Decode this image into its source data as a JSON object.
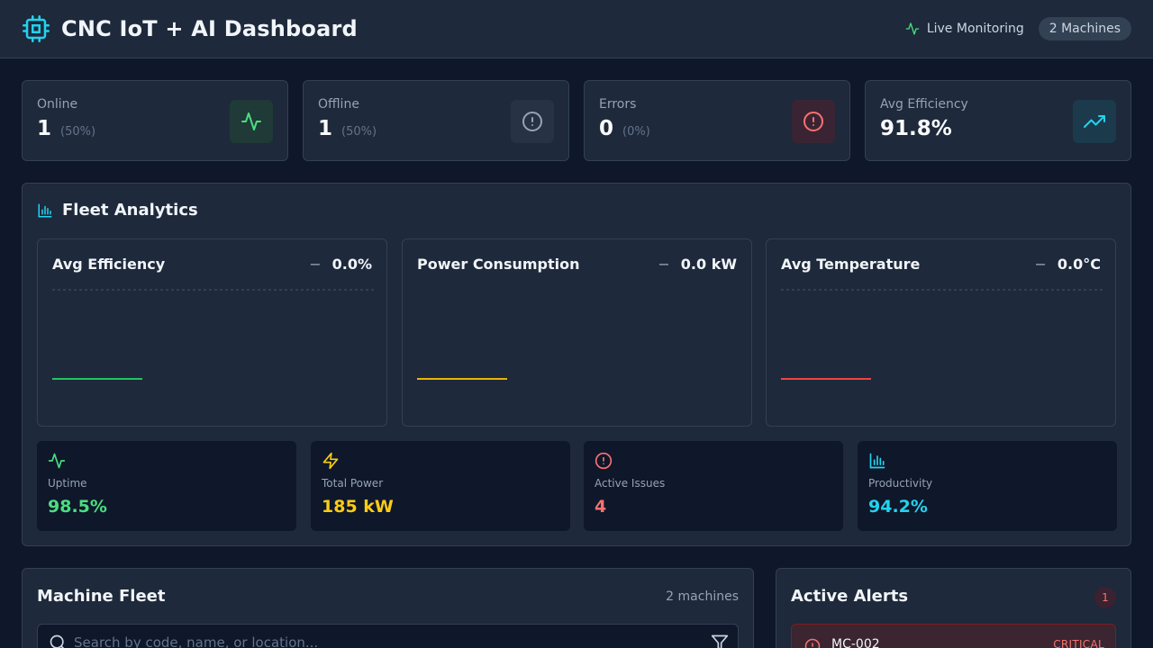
{
  "header": {
    "title": "CNC IoT + AI Dashboard",
    "live_label": "Live Monitoring",
    "machines_pill": "2 Machines",
    "icons": {
      "logo": "cpu-icon",
      "live": "activity-icon"
    }
  },
  "stats": [
    {
      "label": "Online",
      "value": "1",
      "pct": "(50%)",
      "icon": "activity-icon",
      "color": "#4ade80"
    },
    {
      "label": "Offline",
      "value": "1",
      "pct": "(50%)",
      "icon": "alert-circle-icon",
      "color": "#94a3b8"
    },
    {
      "label": "Errors",
      "value": "0",
      "pct": "(0%)",
      "icon": "alert-circle-icon",
      "color": "#f87171"
    },
    {
      "label": "Avg Efficiency",
      "value": "91.8%",
      "pct": "",
      "icon": "trending-up-icon",
      "color": "#22d3ee"
    }
  ],
  "analytics": {
    "title": "Fleet Analytics",
    "icon": "bar-chart-icon",
    "charts": [
      {
        "title": "Avg Efficiency",
        "value": "0.0%",
        "trend": "−",
        "color": "#22c55e"
      },
      {
        "title": "Power Consumption",
        "value": "0.0 kW",
        "trend": "−",
        "color": "#eab308"
      },
      {
        "title": "Avg Temperature",
        "value": "0.0°C",
        "trend": "−",
        "color": "#ef4444"
      }
    ],
    "metrics": [
      {
        "label": "Uptime",
        "value": "98.5%",
        "icon": "activity-icon",
        "color": "#4ade80"
      },
      {
        "label": "Total Power",
        "value": "185 kW",
        "icon": "zap-icon",
        "color": "#facc15"
      },
      {
        "label": "Active Issues",
        "value": "4",
        "icon": "alert-circle-icon",
        "color": "#f87171"
      },
      {
        "label": "Productivity",
        "value": "94.2%",
        "icon": "bar-chart-icon",
        "color": "#22d3ee"
      }
    ]
  },
  "fleet": {
    "title": "Machine Fleet",
    "count": "2 machines",
    "search_placeholder": "Search by code, name, or location..."
  },
  "alerts": {
    "title": "Active Alerts",
    "badge": "1",
    "items": [
      {
        "code": "MC-002",
        "severity": "CRITICAL"
      }
    ]
  }
}
